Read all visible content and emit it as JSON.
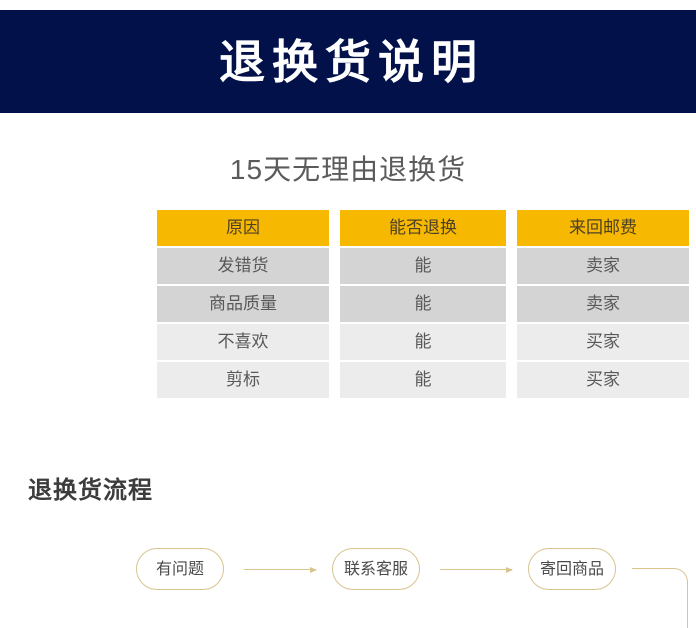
{
  "banner": {
    "title": "退换货说明",
    "background_color": "#03114a",
    "text_color": "#ffffff"
  },
  "subtitle": {
    "text": "15天无理由退换货",
    "color": "#5b5b5b"
  },
  "table": {
    "header_color": "#f6b800",
    "row_dark_color": "#d4d4d4",
    "row_light_color": "#ececec",
    "headers": [
      "原因",
      "能否退换",
      "来回邮费"
    ],
    "rows": [
      [
        "发错货",
        "能",
        "卖家"
      ],
      [
        "商品质量",
        "能",
        "卖家"
      ],
      [
        "不喜欢",
        "能",
        "买家"
      ],
      [
        "剪标",
        "能",
        "买家"
      ]
    ]
  },
  "flow": {
    "heading": "退换货流程",
    "line_color": "#d9c48e",
    "steps": [
      "有问题",
      "联系客服",
      "寄回商品"
    ]
  }
}
